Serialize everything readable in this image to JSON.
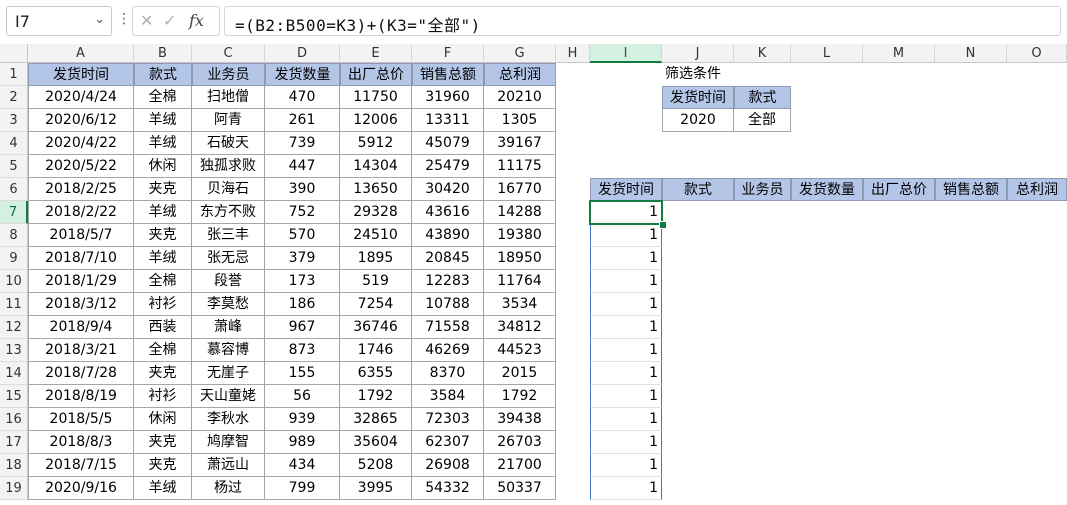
{
  "formula_bar": {
    "name_box": "I7",
    "formula": "=(B2:B500=K3)+(K3=\"全部\")",
    "icons": [
      "cancel-icon",
      "enter-icon",
      "function-icon"
    ]
  },
  "columns": [
    "A",
    "B",
    "C",
    "D",
    "E",
    "F",
    "G",
    "H",
    "I",
    "J",
    "K",
    "L",
    "M",
    "N",
    "O"
  ],
  "selected_column": "I",
  "rows": [
    "1",
    "2",
    "3",
    "4",
    "5",
    "6",
    "7",
    "8",
    "9",
    "10",
    "11",
    "12",
    "13",
    "14",
    "15",
    "16",
    "17",
    "18",
    "19"
  ],
  "selected_row": "7",
  "table": {
    "headers": [
      "发货时间",
      "款式",
      "业务员",
      "发货数量",
      "出厂总价",
      "销售总额",
      "总利润"
    ],
    "rows": [
      [
        "2020/4/24",
        "全棉",
        "扫地僧",
        "470",
        "11750",
        "31960",
        "20210"
      ],
      [
        "2020/6/12",
        "羊绒",
        "阿青",
        "261",
        "12006",
        "13311",
        "1305"
      ],
      [
        "2020/4/22",
        "羊绒",
        "石破天",
        "739",
        "5912",
        "45079",
        "39167"
      ],
      [
        "2020/5/22",
        "休闲",
        "独孤求败",
        "447",
        "14304",
        "25479",
        "11175"
      ],
      [
        "2018/2/25",
        "夹克",
        "贝海石",
        "390",
        "13650",
        "30420",
        "16770"
      ],
      [
        "2018/2/22",
        "羊绒",
        "东方不败",
        "752",
        "29328",
        "43616",
        "14288"
      ],
      [
        "2018/5/7",
        "夹克",
        "张三丰",
        "570",
        "24510",
        "43890",
        "19380"
      ],
      [
        "2018/7/10",
        "羊绒",
        "张无忌",
        "379",
        "1895",
        "20845",
        "18950"
      ],
      [
        "2018/1/29",
        "全棉",
        "段誉",
        "173",
        "519",
        "12283",
        "11764"
      ],
      [
        "2018/3/12",
        "衬衫",
        "李莫愁",
        "186",
        "7254",
        "10788",
        "3534"
      ],
      [
        "2018/9/4",
        "西装",
        "萧峰",
        "967",
        "36746",
        "71558",
        "34812"
      ],
      [
        "2018/3/21",
        "全棉",
        "慕容博",
        "873",
        "1746",
        "46269",
        "44523"
      ],
      [
        "2018/7/28",
        "夹克",
        "无崖子",
        "155",
        "6355",
        "8370",
        "2015"
      ],
      [
        "2018/8/19",
        "衬衫",
        "天山童姥",
        "56",
        "1792",
        "3584",
        "1792"
      ],
      [
        "2018/5/5",
        "休闲",
        "李秋水",
        "939",
        "32865",
        "72303",
        "39438"
      ],
      [
        "2018/8/3",
        "夹克",
        "鸠摩智",
        "989",
        "35604",
        "62307",
        "26703"
      ],
      [
        "2018/7/15",
        "夹克",
        "萧远山",
        "434",
        "5208",
        "26908",
        "21700"
      ],
      [
        "2020/9/16",
        "羊绒",
        "杨过",
        "799",
        "3995",
        "54332",
        "50337"
      ]
    ]
  },
  "filter": {
    "title": "筛选条件",
    "headers": [
      "发货时间",
      "款式"
    ],
    "values": [
      "2020",
      "全部"
    ]
  },
  "result": {
    "headers": [
      "发货时间",
      "款式",
      "业务员",
      "发货数量",
      "出厂总价",
      "销售总额",
      "总利润"
    ],
    "column_i_values": [
      "1",
      "1",
      "1",
      "1",
      "1",
      "1",
      "1",
      "1",
      "1",
      "1",
      "1",
      "1",
      "1"
    ]
  },
  "colors": {
    "header_fill": "#b4c6e7",
    "selection_green": "#107c41"
  }
}
